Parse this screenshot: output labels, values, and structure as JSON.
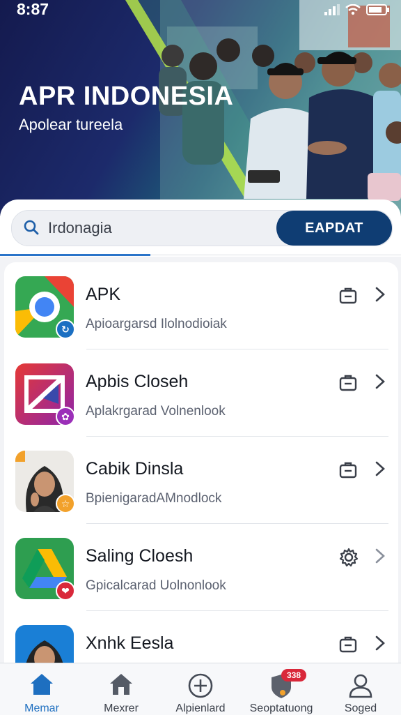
{
  "status": {
    "time": "8:87"
  },
  "hero": {
    "title": "APR INDONESIA",
    "subtitle": "Apolear tureela"
  },
  "search": {
    "query": "Irdonagia",
    "button_label": "EAPDAT"
  },
  "apps": [
    {
      "name": "APK",
      "subtitle": "Apioargarsd Ilolnodioiak",
      "action_icon": "briefcase-icon",
      "badge_color": "#1b6fc2"
    },
    {
      "name": "Apbis Closeh",
      "subtitle": "Aplakrgarad Volnenlook",
      "action_icon": "briefcase-icon",
      "badge_color": "#9b2fb8"
    },
    {
      "name": "Cabik Dinsla",
      "subtitle": "BpienigaradAMnodlock",
      "action_icon": "briefcase-icon",
      "badge_color": "#f2a12b"
    },
    {
      "name": "Saling Cloesh",
      "subtitle": "Gpicalcarad Uolnonlook",
      "action_icon": "gear-icon",
      "badge_color": "#d9283a"
    },
    {
      "name": "Xnhk Eesla",
      "subtitle": "",
      "action_icon": "briefcase-icon",
      "badge_color": ""
    }
  ],
  "nav": {
    "items": [
      {
        "label": "Memar",
        "icon": "home-icon",
        "active": true
      },
      {
        "label": "Mexrer",
        "icon": "home-outline-icon",
        "active": false
      },
      {
        "label": "Alpienlard",
        "icon": "add-circle-icon",
        "active": false
      },
      {
        "label": "Seoptatuong",
        "icon": "shield-icon",
        "active": false,
        "badge": "338"
      },
      {
        "label": "Soged",
        "icon": "user-icon",
        "active": false
      }
    ]
  },
  "colors": {
    "accent": "#0f3d73",
    "active_nav": "#1e6fc0",
    "badge": "#d9283a"
  }
}
